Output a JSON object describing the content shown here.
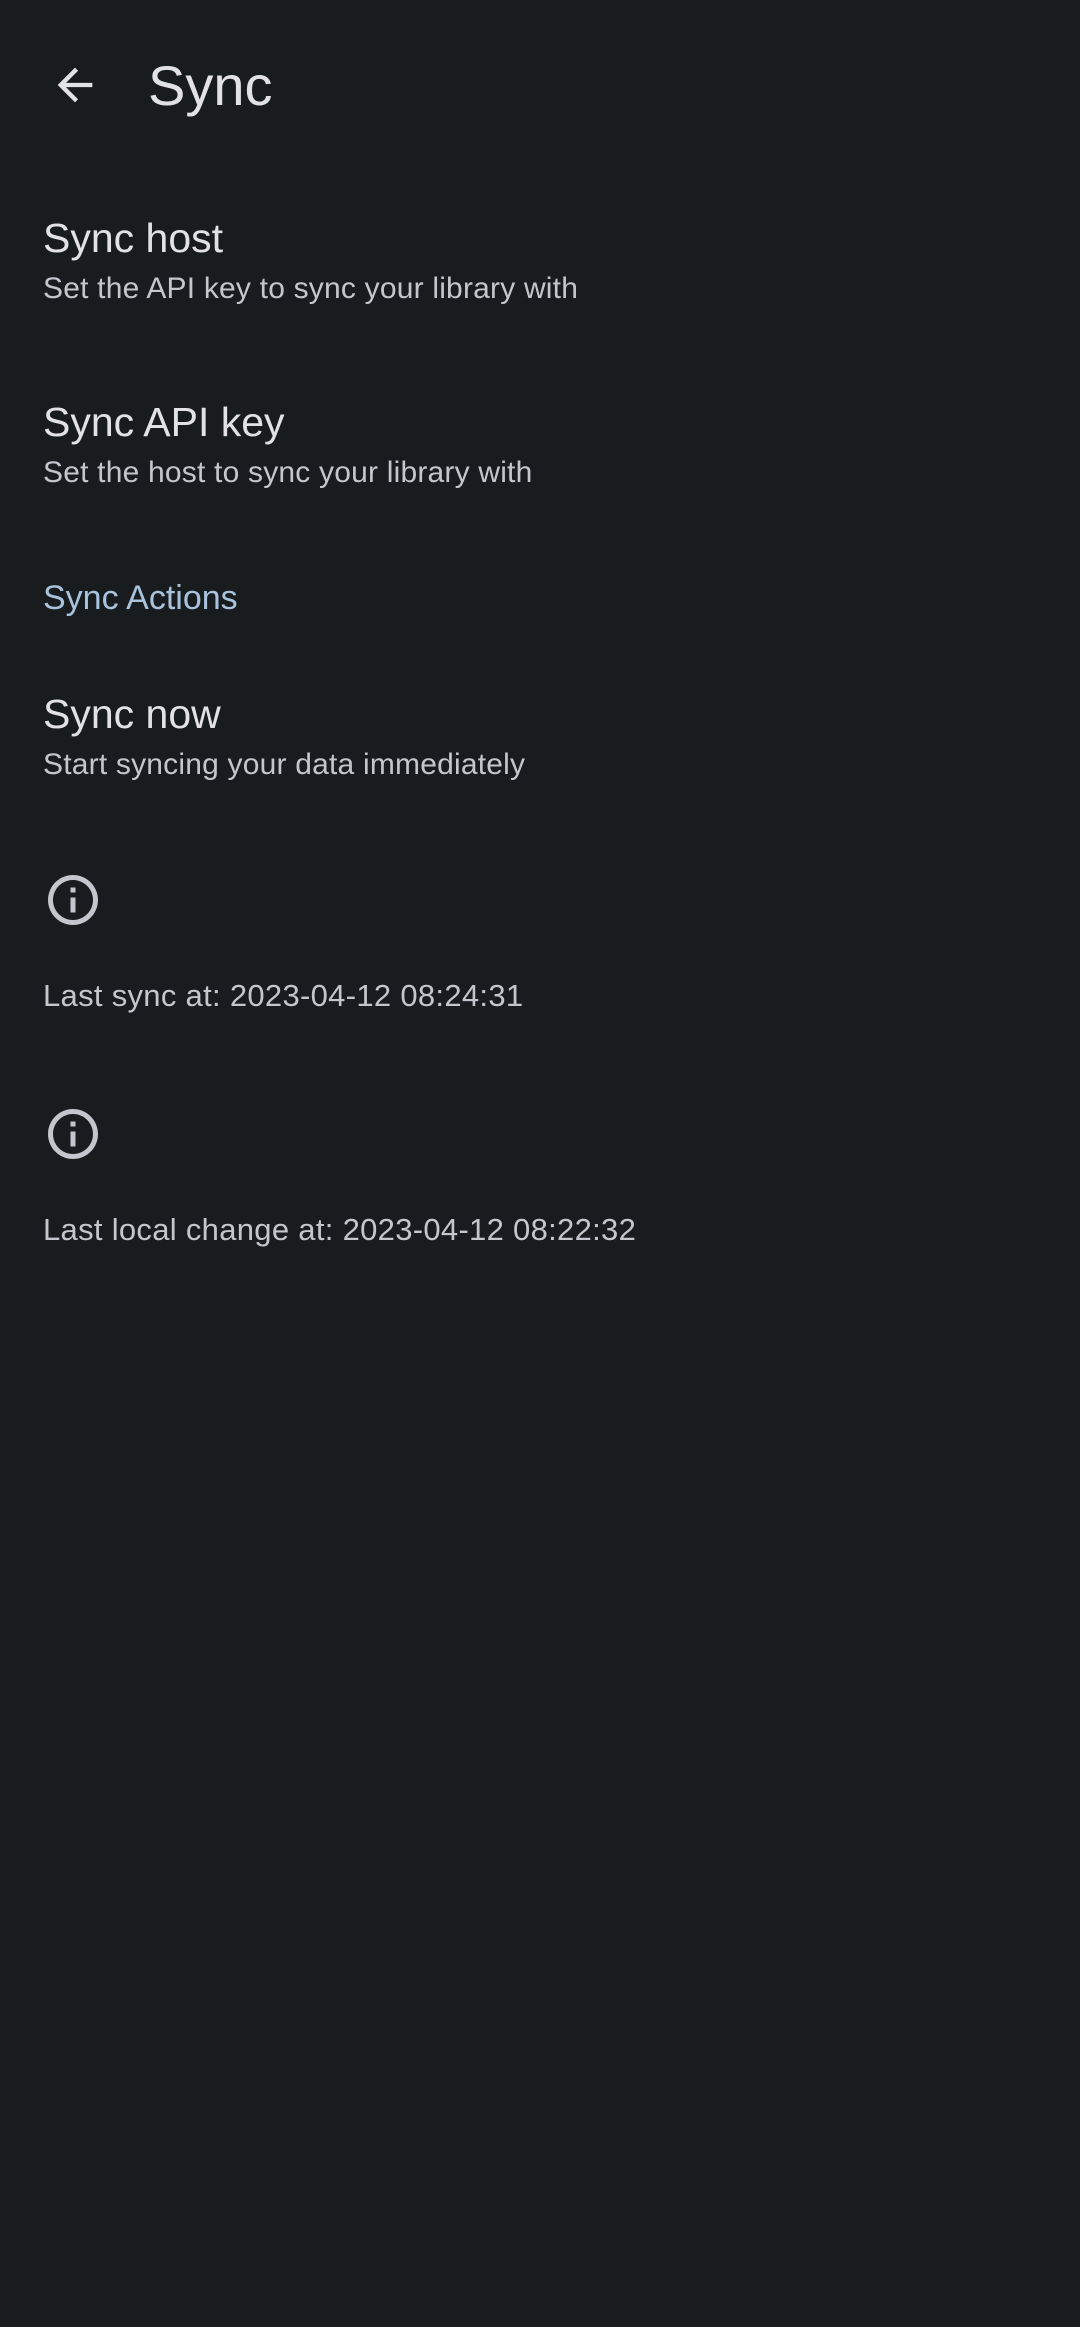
{
  "app_bar": {
    "back_icon": "arrow-back-icon",
    "title": "Sync"
  },
  "preferences": [
    {
      "title": "Sync host",
      "summary": "Set the API key to sync your library with"
    },
    {
      "title": "Sync API key",
      "summary": "Set the host to sync your library with"
    }
  ],
  "sync_actions": {
    "header": "Sync Actions",
    "sync_now": {
      "title": "Sync now",
      "summary": "Start syncing your data immediately"
    }
  },
  "info": [
    {
      "icon": "info-icon",
      "text": "Last sync at: 2023-04-12 08:24:31"
    },
    {
      "icon": "info-icon",
      "text": "Last local change at: 2023-04-12 08:22:32"
    }
  ],
  "colors": {
    "background": "#191c1f",
    "primary_text": "#e2e2e6",
    "secondary_text": "#c3c6cc",
    "section_header": "#a9c3dc"
  }
}
